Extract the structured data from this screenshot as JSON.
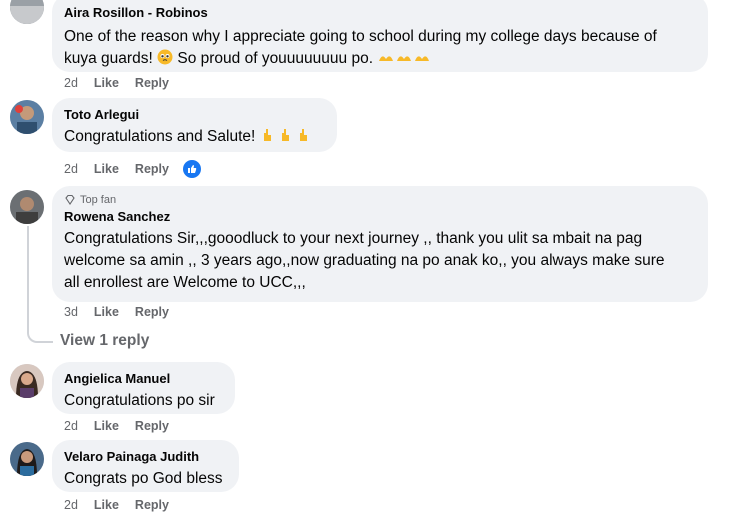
{
  "comments": [
    {
      "author": "Aira Rosillon - Robinos",
      "text_parts": [
        "One of the reason why I appreciate going to school during my college days because of",
        "kuya guards! ",
        " So proud of youuuuuuuu po. "
      ],
      "time": "2d",
      "like": "Like",
      "reply": "Reply"
    },
    {
      "author": "Toto Arlegui",
      "text": "Congratulations and Salute! ",
      "time": "2d",
      "like": "Like",
      "reply": "Reply",
      "reaction_icon": "like-reaction-icon"
    },
    {
      "badge": "Top fan",
      "author": "Rowena Sanchez",
      "text_lines": [
        "Congratulations Sir,,,gooodluck to your next journey ,, thank you ulit sa mbait na pag",
        "welcome sa amin ,, 3 years ago,,now graduating na po anak ko,, you always make sure",
        "all enrollest are Welcome to UCC,,,"
      ],
      "time": "3d",
      "like": "Like",
      "reply": "Reply",
      "view_replies": "View 1 reply"
    },
    {
      "author": "Angielica Manuel",
      "text": "Congratulations po sir",
      "time": "2d",
      "like": "Like",
      "reply": "Reply"
    },
    {
      "author": "Velaro Painaga Judith",
      "text": "Congrats po God bless",
      "time": "2d",
      "like": "Like",
      "reply": "Reply"
    }
  ],
  "colors": {
    "bubble": "#f0f2f5",
    "meta": "#65676b",
    "accent": "#1877f2",
    "emoji": "#f7b928"
  }
}
